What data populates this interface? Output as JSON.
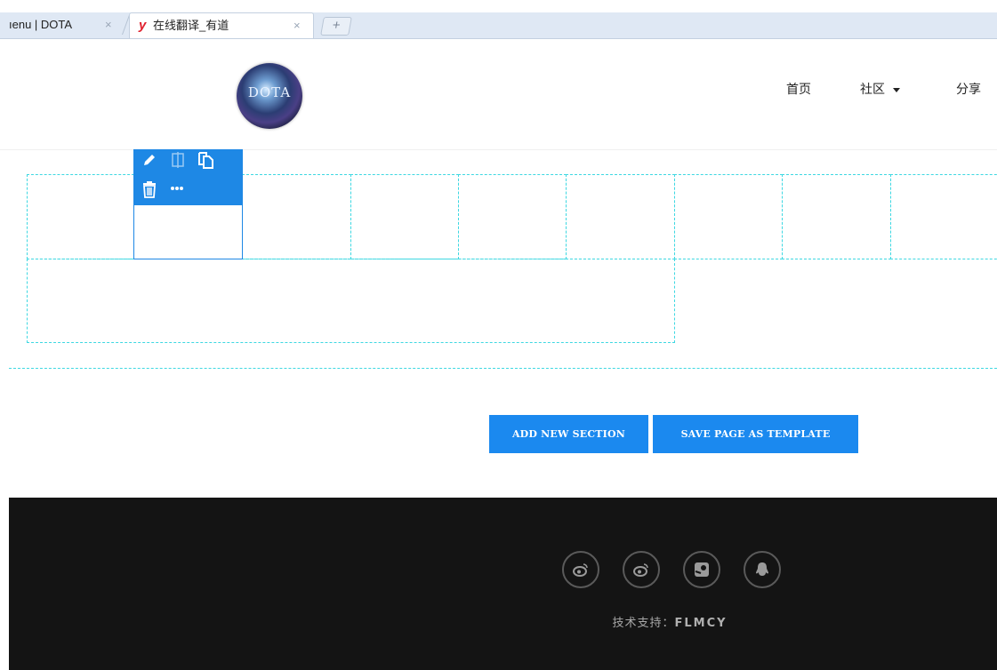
{
  "browser": {
    "tabs": [
      {
        "label": "ıenu | DOTA"
      },
      {
        "label": "在线翻译_有道",
        "icon_letter": "y"
      }
    ],
    "close_glyph": "×",
    "new_tab_glyph": "+"
  },
  "header": {
    "logo_text": "DOTA",
    "nav": {
      "home": "首页",
      "community": "社区",
      "share": "分享"
    }
  },
  "builder": {
    "toolbar_icons": [
      "edit-icon",
      "split-icon",
      "copy-icon",
      "trash-icon",
      "more-icon"
    ],
    "accent_color": "#1e88e5",
    "guide_color": "#3ed8e2"
  },
  "actions": {
    "add_section": "ADD NEW SECTION",
    "save_template": "SAVE PAGE AS TEMPLATE"
  },
  "footer": {
    "social_icons": [
      "weibo-icon",
      "weibo-icon",
      "steam-icon",
      "qq-icon"
    ],
    "support_label": "技术支持：",
    "support_name": "FLMCY"
  }
}
